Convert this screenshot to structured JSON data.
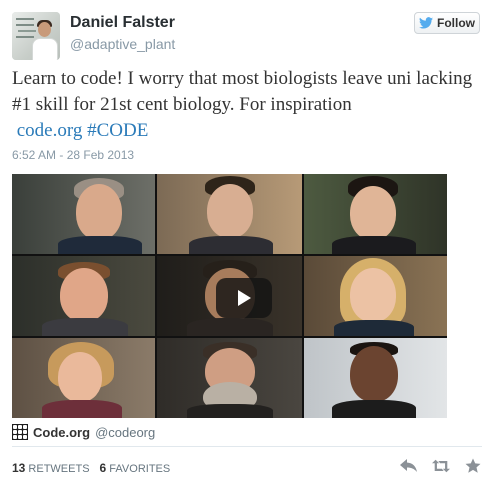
{
  "user": {
    "name": "Daniel Falster",
    "handle": "@adaptive_plant"
  },
  "follow_button": {
    "label": "Follow"
  },
  "tweet": {
    "text": "Learn to code! I worry that most biologists leave uni lacking #1 skill for 21st cent biology. For inspiration",
    "link": "code.org",
    "hashtag": "#CODE",
    "timestamp": "6:52 AM - 28 Feb 2013"
  },
  "media": {
    "type": "video",
    "play_icon": "play-icon"
  },
  "card": {
    "name": "Code.org",
    "handle": "@codeorg",
    "logo_icon": "code-org-logo-icon"
  },
  "stats": {
    "retweets_count": "13",
    "retweets_label": "RETWEETS",
    "favorites_count": "6",
    "favorites_label": "FAVORITES"
  },
  "actions": {
    "reply_icon": "reply-icon",
    "retweet_icon": "retweet-icon",
    "favorite_icon": "star-icon"
  },
  "colors": {
    "link": "#2b7bb9",
    "muted": "#8899a6",
    "twitter_bird": "#55acee"
  }
}
